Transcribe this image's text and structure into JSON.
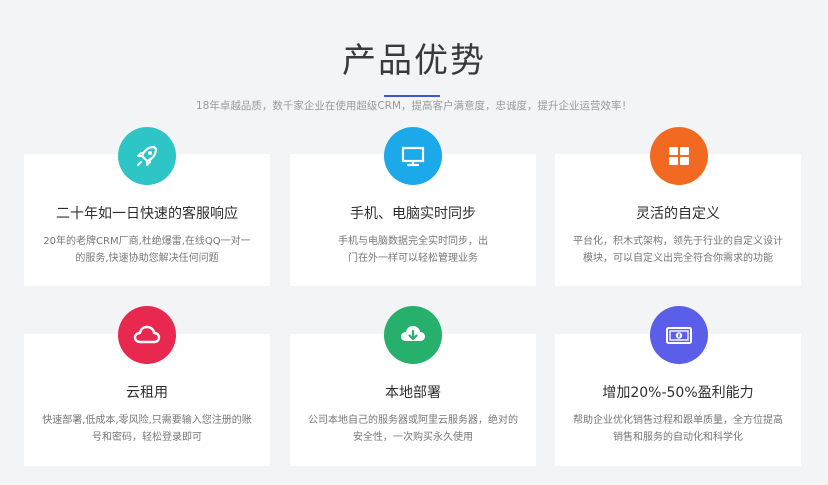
{
  "header": {
    "title": "产品优势",
    "subtitle": "18年卓越品质，数千家企业在使用超级CRM，提高客户满意度，忠诚度，提升企业运营效率！",
    "accent_color": "#3b57d6"
  },
  "features": [
    {
      "icon": "rocket-icon",
      "color": "#2ec5c7",
      "title": "二十年如一日快速的客服响应",
      "desc": "20年的老牌CRM厂商,杜绝爆雷,在线QQ一对一的服务,快速协助您解决任何问题"
    },
    {
      "icon": "monitor-icon",
      "color": "#1ba9ea",
      "title": "手机、电脑实时同步",
      "desc": "手机与电脑数据完全实时同步，出门在外一样可以轻松管理业务"
    },
    {
      "icon": "grid-icon",
      "color": "#f26a21",
      "title": "灵活的自定义",
      "desc": "平台化，积木式架构，领先于行业的自定义设计模块，可以自定义出完全符合你需求的功能"
    },
    {
      "icon": "cloud-icon",
      "color": "#e8284e",
      "title": "云租用",
      "desc": "快速部署,低成本,零风险,只需要输入您注册的账号和密码，轻松登录即可"
    },
    {
      "icon": "cloud-download-icon",
      "color": "#27b06b",
      "title": "本地部署",
      "desc": "公司本地自己的服务器或阿里云服务器，绝对的安全性，一次购买永久使用"
    },
    {
      "icon": "money-icon",
      "color": "#5a5ee8",
      "title": "增加20%-50%盈利能力",
      "desc": "帮助企业优化销售过程和跟单质量，全方位提高销售和服务的自动化和科学化"
    }
  ]
}
